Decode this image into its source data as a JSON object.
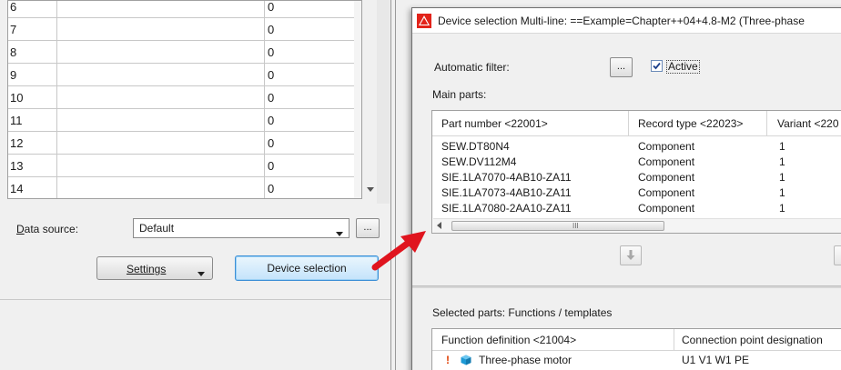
{
  "left_panel": {
    "rows": [
      {
        "num": "6",
        "value": "0"
      },
      {
        "num": "7",
        "value": "0"
      },
      {
        "num": "8",
        "value": "0"
      },
      {
        "num": "9",
        "value": "0"
      },
      {
        "num": "10",
        "value": "0"
      },
      {
        "num": "11",
        "value": "0"
      },
      {
        "num": "12",
        "value": "0"
      },
      {
        "num": "13",
        "value": "0"
      },
      {
        "num": "14",
        "value": "0"
      }
    ],
    "data_source_label": "Data source:",
    "data_source_value": "Default",
    "more_button_label": "...",
    "settings_label": "Settings",
    "device_selection_label": "Device selection"
  },
  "dialog": {
    "title": "Device selection Multi-line: ==Example=Chapter++04+4.8-M2 (Three-phase",
    "automatic_filter_label": "Automatic filter:",
    "filter_button_label": "...",
    "active_label": "Active",
    "active_checked": true,
    "main_parts_label": "Main parts:",
    "main_parts_columns": [
      "Part number <22001>",
      "Record type <22023>",
      "Variant <220"
    ],
    "main_parts_rows": [
      {
        "part": "SEW.DT80N4",
        "record": "Component",
        "variant": "1"
      },
      {
        "part": "SEW.DV112M4",
        "record": "Component",
        "variant": "1"
      },
      {
        "part": "SIE.1LA7070-4AB10-ZA11",
        "record": "Component",
        "variant": "1"
      },
      {
        "part": "SIE.1LA7073-4AB10-ZA11",
        "record": "Component",
        "variant": "1"
      },
      {
        "part": "SIE.1LA7080-2AA10-ZA11",
        "record": "Component",
        "variant": "1"
      }
    ],
    "scroll_grip": "III",
    "selected_parts_label": "Selected parts: Functions / templates",
    "selected_parts_columns": [
      "Function definition <21004>",
      "Connection point designation"
    ],
    "selected_parts_rows": [
      {
        "warning": "!",
        "function": "Three-phase motor",
        "connection": "U1 V1 W1 PE"
      }
    ]
  },
  "colors": {
    "accent_blue": "#3c8fd6",
    "arrow_red": "#e0141e",
    "warning_orange": "#e03c00",
    "cube_blue": "#1e9ad6"
  }
}
